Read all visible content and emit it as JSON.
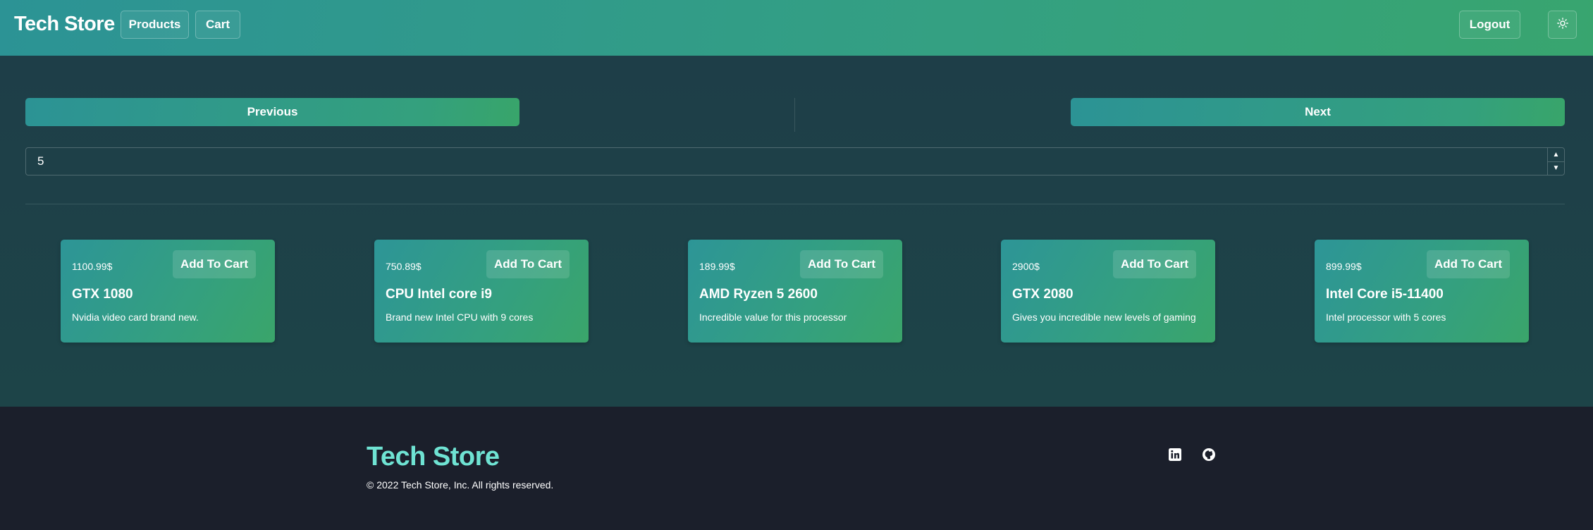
{
  "header": {
    "brand": "Tech Store",
    "nav": {
      "products": "Products",
      "cart": "Cart",
      "logout": "Logout"
    },
    "theme_icon": "sun-icon"
  },
  "pager": {
    "previous_label": "Previous",
    "next_label": "Next",
    "page_size_value": "5"
  },
  "products": [
    {
      "price": "1100.99$",
      "add_label": "Add To Cart",
      "title": "GTX 1080",
      "description": "Nvidia video card brand new."
    },
    {
      "price": "750.89$",
      "add_label": "Add To Cart",
      "title": "CPU Intel core i9",
      "description": "Brand new Intel CPU with 9 cores"
    },
    {
      "price": "189.99$",
      "add_label": "Add To Cart",
      "title": "AMD Ryzen 5 2600",
      "description": "Incredible value for this processor"
    },
    {
      "price": "2900$",
      "add_label": "Add To Cart",
      "title": "GTX 2080",
      "description": "Gives you incredible new levels of gaming"
    },
    {
      "price": "899.99$",
      "add_label": "Add To Cart",
      "title": "Intel Core i5-11400",
      "description": "Intel processor with 5 cores"
    }
  ],
  "footer": {
    "brand": "Tech Store",
    "copyright": "© 2022 Tech Store, Inc. All rights reserved.",
    "social_icons": [
      "linkedin-icon",
      "github-icon"
    ]
  },
  "colors": {
    "accent_teal": "#2c9395",
    "accent_green": "#38a56f",
    "footer_brand": "#6fe3d3",
    "footer_bg": "#1b1f2b"
  }
}
